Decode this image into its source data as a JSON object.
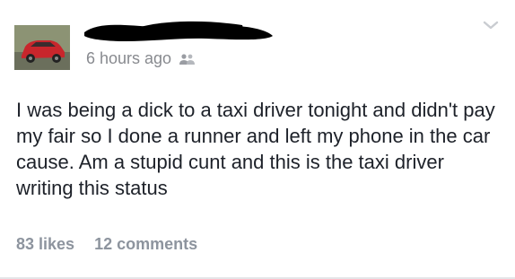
{
  "post": {
    "timestamp": "6 hours ago",
    "audience_icon": "friends-icon",
    "status_text": "I was being a dick to a taxi driver tonight and didn't pay my fair so I done a runner and left my phone in the car cause. Am a stupid cunt and this is the taxi driver writing this status",
    "likes": "83 likes",
    "comments": "12 comments"
  }
}
